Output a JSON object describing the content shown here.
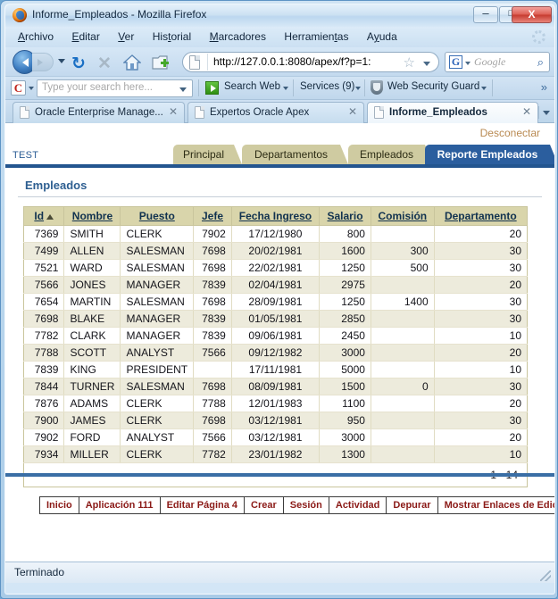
{
  "window": {
    "title": "Informe_Empleados - Mozilla Firefox",
    "minimize_label": "–",
    "maximize_label": "□",
    "close_label": "X"
  },
  "menubar": {
    "items": [
      {
        "label": "Archivo",
        "accel": "A"
      },
      {
        "label": "Editar",
        "accel": "E"
      },
      {
        "label": "Ver",
        "accel": "V"
      },
      {
        "label": "Historial",
        "accel": "H"
      },
      {
        "label": "Marcadores",
        "accel": "M"
      },
      {
        "label": "Herramientas",
        "accel": "H"
      },
      {
        "label": "Ayuda",
        "accel": "y"
      }
    ]
  },
  "navbar": {
    "back_icon": "back-arrow-icon",
    "forward_icon": "forward-arrow-icon",
    "reload_label": "↻",
    "stop_label": "✕",
    "home_icon": "home-icon",
    "newtab_icon": "new-tab-icon",
    "url": "http://127.0.0.1:8080/apex/f?p=1:",
    "bookmark_star": "☆",
    "search_engine": "G",
    "search_placeholder": "Google",
    "search_icon": "⌕"
  },
  "addonbar": {
    "brand_icon": "C",
    "search_placeholder": "Type your search here...",
    "search_web_label": "Search Web",
    "services_label": "Services (9)",
    "web_security_label": "Web Security Guard",
    "overflow_label": "»"
  },
  "browser_tabs": [
    {
      "label": "Oracle Enterprise Manage...",
      "close": "✕",
      "active": false
    },
    {
      "label": "Expertos Oracle Apex",
      "close": "✕",
      "active": false
    },
    {
      "label": "Informe_Empleados",
      "close": "✕",
      "active": true
    }
  ],
  "page": {
    "logout_label": "Desconectar",
    "workspace": "TEST",
    "app_tabs": [
      {
        "label": "Principal",
        "selected": false
      },
      {
        "label": "Departamentos",
        "selected": false
      },
      {
        "label": "Empleados",
        "selected": false
      },
      {
        "label": "Reporte Empleados",
        "selected": true
      }
    ],
    "region_title": "Empleados",
    "pagination": "1 - 14",
    "sort_indicator": "ascending"
  },
  "report": {
    "columns": [
      "Id",
      "Nombre",
      "Puesto",
      "Jefe",
      "Fecha Ingreso",
      "Salario",
      "Comisión",
      "Departamento"
    ],
    "sorted_column": "Id",
    "rows": [
      {
        "id": "7369",
        "nombre": "SMITH",
        "puesto": "CLERK",
        "jefe": "7902",
        "fecha": "17/12/1980",
        "salario": "800",
        "comision": "",
        "departamento": "20"
      },
      {
        "id": "7499",
        "nombre": "ALLEN",
        "puesto": "SALESMAN",
        "jefe": "7698",
        "fecha": "20/02/1981",
        "salario": "1600",
        "comision": "300",
        "departamento": "30"
      },
      {
        "id": "7521",
        "nombre": "WARD",
        "puesto": "SALESMAN",
        "jefe": "7698",
        "fecha": "22/02/1981",
        "salario": "1250",
        "comision": "500",
        "departamento": "30"
      },
      {
        "id": "7566",
        "nombre": "JONES",
        "puesto": "MANAGER",
        "jefe": "7839",
        "fecha": "02/04/1981",
        "salario": "2975",
        "comision": "",
        "departamento": "20"
      },
      {
        "id": "7654",
        "nombre": "MARTIN",
        "puesto": "SALESMAN",
        "jefe": "7698",
        "fecha": "28/09/1981",
        "salario": "1250",
        "comision": "1400",
        "departamento": "30"
      },
      {
        "id": "7698",
        "nombre": "BLAKE",
        "puesto": "MANAGER",
        "jefe": "7839",
        "fecha": "01/05/1981",
        "salario": "2850",
        "comision": "",
        "departamento": "30"
      },
      {
        "id": "7782",
        "nombre": "CLARK",
        "puesto": "MANAGER",
        "jefe": "7839",
        "fecha": "09/06/1981",
        "salario": "2450",
        "comision": "",
        "departamento": "10"
      },
      {
        "id": "7788",
        "nombre": "SCOTT",
        "puesto": "ANALYST",
        "jefe": "7566",
        "fecha": "09/12/1982",
        "salario": "3000",
        "comision": "",
        "departamento": "20"
      },
      {
        "id": "7839",
        "nombre": "KING",
        "puesto": "PRESIDENT",
        "jefe": "",
        "fecha": "17/11/1981",
        "salario": "5000",
        "comision": "",
        "departamento": "10"
      },
      {
        "id": "7844",
        "nombre": "TURNER",
        "puesto": "SALESMAN",
        "jefe": "7698",
        "fecha": "08/09/1981",
        "salario": "1500",
        "comision": "0",
        "departamento": "30"
      },
      {
        "id": "7876",
        "nombre": "ADAMS",
        "puesto": "CLERK",
        "jefe": "7788",
        "fecha": "12/01/1983",
        "salario": "1100",
        "comision": "",
        "departamento": "20"
      },
      {
        "id": "7900",
        "nombre": "JAMES",
        "puesto": "CLERK",
        "jefe": "7698",
        "fecha": "03/12/1981",
        "salario": "950",
        "comision": "",
        "departamento": "30"
      },
      {
        "id": "7902",
        "nombre": "FORD",
        "puesto": "ANALYST",
        "jefe": "7566",
        "fecha": "03/12/1981",
        "salario": "3000",
        "comision": "",
        "departamento": "20"
      },
      {
        "id": "7934",
        "nombre": "MILLER",
        "puesto": "CLERK",
        "jefe": "7782",
        "fecha": "23/01/1982",
        "salario": "1300",
        "comision": "",
        "departamento": "10"
      }
    ]
  },
  "developer_bar": {
    "links": [
      "Inicio",
      "Aplicación 111",
      "Editar Página 4",
      "Crear",
      "Sesión",
      "Actividad",
      "Depurar",
      "Mostrar Enlaces de Edición"
    ]
  },
  "statusbar": {
    "text": "Terminado"
  },
  "colors": {
    "apex_tab_inactive": "#cfcba1",
    "apex_tab_active": "#2b5e9e",
    "table_header": "#d9d5ab",
    "row_alt": "#edebdc",
    "region_title": "#2e5f91",
    "logout_link": "#b98a52",
    "dev_link": "#8b1a17",
    "blue_rule": "#3a6ea5"
  }
}
